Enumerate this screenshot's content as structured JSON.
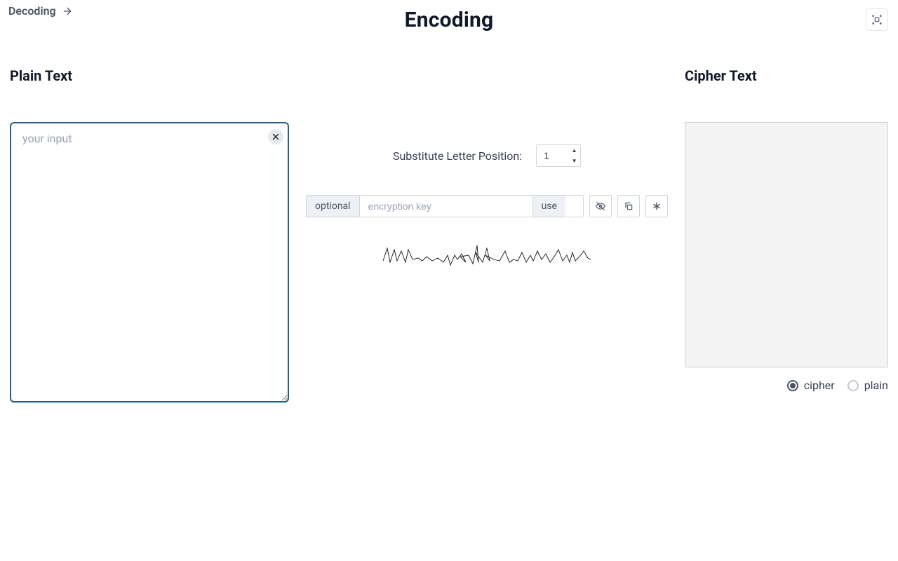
{
  "header": {
    "decoding_link": "Decoding",
    "title": "Encoding"
  },
  "left": {
    "title": "Plain Text",
    "placeholder": "your input",
    "value": ""
  },
  "mid": {
    "substitute_label": "Substitute Letter Position:",
    "position_value": "1",
    "optional_label": "optional",
    "key_placeholder": "encryption key",
    "key_value": "",
    "use_label": "use"
  },
  "right": {
    "title": "Cipher Text",
    "output": "",
    "radios": {
      "cipher": "cipher",
      "plain": "plain",
      "selected": "cipher"
    }
  }
}
